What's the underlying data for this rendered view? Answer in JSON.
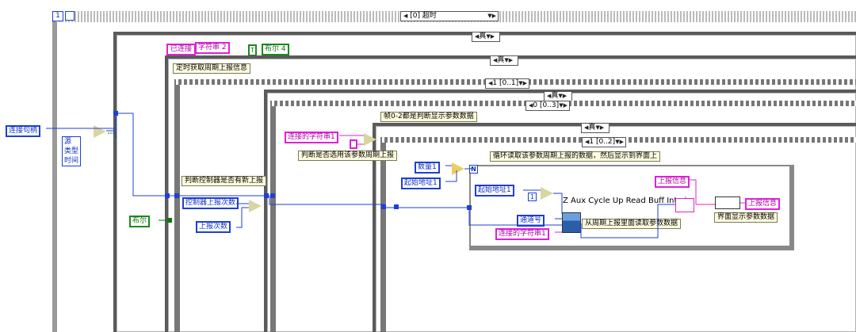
{
  "outer_case": {
    "selector": "[0] 超时",
    "iter": "1"
  },
  "case_true_1": {
    "selector": "真"
  },
  "connected_label": "已连接",
  "string2": "字符串 2",
  "bool_const": "T",
  "bool4": "布尔 4",
  "case_true_2": {
    "selector": "真"
  },
  "timer_label": "定时获取周期上报信息",
  "seq1": {
    "selector": "1 [0..1]"
  },
  "case_true_3": {
    "selector": "真"
  },
  "seq2": {
    "selector": "0 [0..3]"
  },
  "frame_label": "帧0-2都是判断显示参数数据",
  "case_true_4": {
    "selector": "真"
  },
  "seq3": {
    "selector": "1 [0..2]"
  },
  "conn_handle": "连接句柄",
  "source_cluster": [
    "源",
    "类型",
    "时间"
  ],
  "bool_ctl": "布尔",
  "judge_new_report": "判断控制器是否有新上报",
  "ctrl_report_count": "控制器上报次数",
  "report_count": "上报次数",
  "conn_string1": "连接的字符串1",
  "judge_selected": "判断是否选用该参数周期上报",
  "data_count": "数量1",
  "start_addr": "起始地址1",
  "loop_label": "循环读取该参数周期上报的数据，然后显示到界面上",
  "loop_n": "N",
  "start_addr2": "起始地址1",
  "subvi_name": "Z Aux Cycle Up Read Buff Int.vi",
  "channel": "通道号",
  "conn_string2": "连接的字符串1",
  "read_label": "从周期上报里面读取参数数据",
  "report_info_in": "上报信息",
  "report_info_out": "上报信息",
  "display_label": "界面显示参数数据",
  "one_const": "1"
}
